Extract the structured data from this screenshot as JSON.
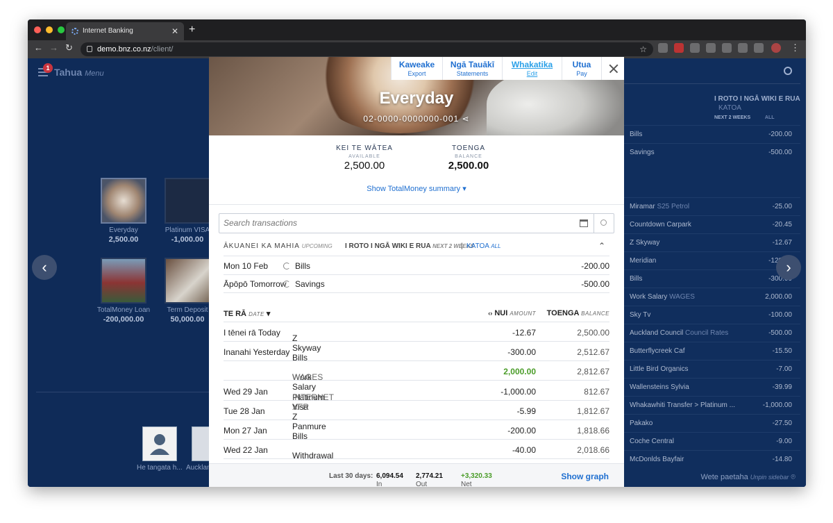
{
  "browser": {
    "tab_title": "Internet Banking",
    "url_host": "demo.bnz.co.nz",
    "url_path": "/client/"
  },
  "app": {
    "badge_count": "1",
    "brand": "Tahua",
    "brand_en": "Menu",
    "tiles": [
      {
        "label": "Everyday",
        "amount": "2,500.00"
      },
      {
        "label": "Platinum VISA",
        "amount": "-1,000.00"
      },
      {
        "label": "TotalMoney Loan",
        "amount": "-200,000.00"
      },
      {
        "label": "Term Deposit",
        "amount": "50,000.00"
      }
    ],
    "person_label": "He tangata h...",
    "partial_label": "Aucklan"
  },
  "sidebar": {
    "head_mi": "I ROTO I NGĀ WIKI E RUA",
    "head_en": "NEXT 2 WEEKS",
    "head_all_mi": "KATOA",
    "head_all_en": "ALL",
    "upcoming": [
      {
        "desc": "Bills",
        "amount": "-200.00"
      },
      {
        "desc": "Savings",
        "amount": "-500.00"
      }
    ],
    "transactions": [
      {
        "desc": "Miramar",
        "ref": "S25 Petrol",
        "amount": "-25.00"
      },
      {
        "desc": "Countdown Carpark",
        "ref": "",
        "amount": "-20.45"
      },
      {
        "desc": "Z Skyway",
        "ref": "",
        "amount": "-12.67"
      },
      {
        "desc": "Meridian",
        "ref": "",
        "amount": "-120.00"
      },
      {
        "desc": "Bills",
        "ref": "",
        "amount": "-300.00"
      },
      {
        "desc": "Work Salary",
        "ref": "WAGES",
        "amount": "2,000.00"
      },
      {
        "desc": "Sky Tv",
        "ref": "",
        "amount": "-100.00"
      },
      {
        "desc": "Auckland Council",
        "ref": "Council Rates",
        "amount": "-500.00"
      },
      {
        "desc": "Butterflycreek Caf",
        "ref": "",
        "amount": "-15.50"
      },
      {
        "desc": "Little Bird Organics",
        "ref": "",
        "amount": "-7.00"
      },
      {
        "desc": "Wallensteins Sylvia",
        "ref": "",
        "amount": "-39.99"
      },
      {
        "desc": "Whakawhiti Transfer > Platinum ...",
        "ref": "",
        "amount": "-1,000.00"
      },
      {
        "desc": "Pakako",
        "ref": "",
        "amount": "-27.50"
      },
      {
        "desc": "Coche Central",
        "ref": "",
        "amount": "-9.00"
      },
      {
        "desc": "McDonlds Bayfair",
        "ref": "",
        "amount": "-14.80"
      }
    ],
    "footer_mi": "Wete paetaha",
    "footer_en": "Unpin sidebar"
  },
  "modal": {
    "title": "Everyday",
    "account_number": "02-0000-0000000-001",
    "actions": [
      {
        "mi": "Kaweake",
        "en": "Export"
      },
      {
        "mi": "Ngā Tauākī",
        "en": "Statements"
      },
      {
        "mi": "Whakatika",
        "en": "Edit"
      },
      {
        "mi": "Utua",
        "en": "Pay"
      }
    ],
    "available_mi": "KEI TE WĀTEA",
    "available_en": "AVAILABLE",
    "available_amount": "2,500.00",
    "balance_mi": "TOENGA",
    "balance_en": "BALANCE",
    "balance_amount": "2,500.00",
    "summary_link": "Show TotalMoney summary ▾",
    "search_placeholder": "Search transactions",
    "upcoming_head": {
      "mi": "ĀKUANEI KA MAHIA",
      "en": "UPCOMING",
      "range_mi": "I ROTO I NGĀ WIKI E RUA",
      "range_en": "NEXT 2 WEEKS",
      "sep": "|",
      "all_mi": "KATOA",
      "all_en": "ALL"
    },
    "upcoming": [
      {
        "date": "Mon 10 Feb",
        "desc": "Bills",
        "amount": "-200.00"
      },
      {
        "date": "Āpōpō Tomorrow",
        "desc": "Savings",
        "amount": "-500.00"
      }
    ],
    "table_head": {
      "date_mi": "TE RĀ",
      "date_en": "DATE",
      "amount_mi": "NUI",
      "amount_en": "AMOUNT",
      "balance_mi": "TOENGA",
      "balance_en": "BALANCE"
    },
    "transactions": [
      {
        "date": "I tēnei rā Today",
        "desc": "Z Skyway",
        "ref": "",
        "amount": "-12.67",
        "balance": "2,500.00"
      },
      {
        "date": "Inanahi Yesterday",
        "desc": "Bills",
        "ref": "",
        "amount": "-300.00",
        "balance": "2,512.67"
      },
      {
        "date": "",
        "desc": "Work Salary",
        "ref": "WAGES",
        "amount": "2,000.00",
        "balance": "2,812.67"
      },
      {
        "date": "Wed 29 Jan",
        "desc": "Platinum Visa",
        "ref": "INTERNET XFR",
        "amount": "-1,000.00",
        "balance": "812.67"
      },
      {
        "date": "Tue 28 Jan",
        "desc": "Z Panmure",
        "ref": "",
        "amount": "-5.99",
        "balance": "1,812.67"
      },
      {
        "date": "Mon 27 Jan",
        "desc": "Bills",
        "ref": "",
        "amount": "-200.00",
        "balance": "1,818.66"
      },
      {
        "date": "Wed 22 Jan",
        "desc": "Withdrawal",
        "ref": "",
        "amount": "-40.00",
        "balance": "2,018.66"
      }
    ],
    "footer": {
      "period": "Last 30 days:",
      "in_label": "In",
      "in_value": "6,094.54",
      "out_label": "Out",
      "out_value": "2,774.21",
      "net_label": "Net",
      "net_value": "+3,320.33",
      "graph_link": "Show graph"
    }
  }
}
